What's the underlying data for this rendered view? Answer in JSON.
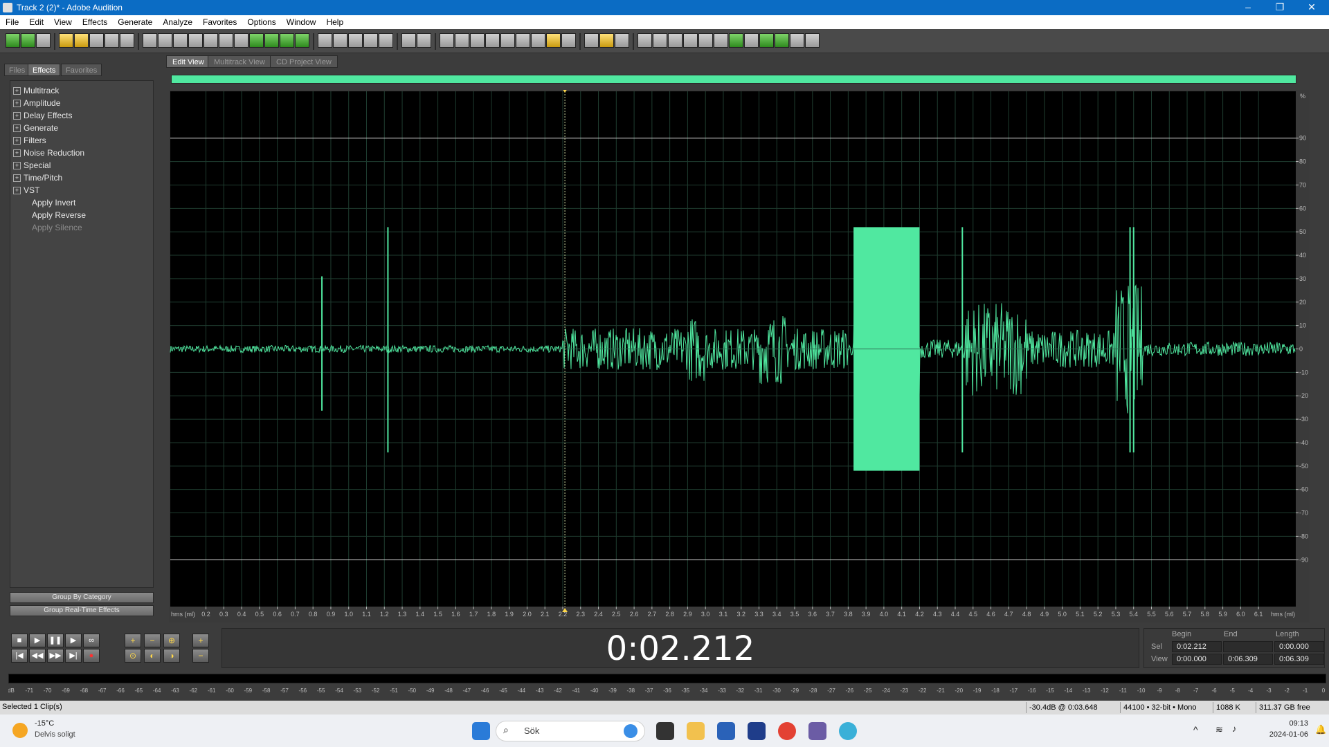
{
  "window": {
    "title": "Track 2 (2)* - Adobe Audition",
    "minimize": "–",
    "maximize": "❐",
    "close": "✕"
  },
  "menu": [
    "File",
    "Edit",
    "View",
    "Effects",
    "Generate",
    "Analyze",
    "Favorites",
    "Options",
    "Window",
    "Help"
  ],
  "panel": {
    "tabs": [
      "Files",
      "Effects",
      "Favorites"
    ],
    "active_tab": "Effects",
    "categories": [
      "Multitrack",
      "Amplitude",
      "Delay Effects",
      "Generate",
      "Filters",
      "Noise Reduction",
      "Special",
      "Time/Pitch",
      "VST"
    ],
    "actions": [
      "Apply Invert",
      "Apply Reverse",
      "Apply Silence"
    ],
    "group_by_category": "Group By Category",
    "group_realtime": "Group Real-Time Effects"
  },
  "views": {
    "tabs": [
      "Edit View",
      "Multitrack View",
      "CD Project View"
    ],
    "active": "Edit View"
  },
  "waveform": {
    "time_unit_left": "hms (ml)",
    "time_unit_right": "hms (ml)",
    "time_ticks": [
      "0.2",
      "0.3",
      "0.4",
      "0.5",
      "0.6",
      "0.7",
      "0.8",
      "0.9",
      "1.0",
      "1.1",
      "1.2",
      "1.3",
      "1.4",
      "1.5",
      "1.6",
      "1.7",
      "1.8",
      "1.9",
      "2.0",
      "2.1",
      "2.2",
      "2.3",
      "2.4",
      "2.5",
      "2.6",
      "2.7",
      "2.8",
      "2.9",
      "3.0",
      "3.1",
      "3.2",
      "3.3",
      "3.4",
      "3.5",
      "3.6",
      "3.7",
      "3.8",
      "3.9",
      "4.0",
      "4.1",
      "4.2",
      "4.3",
      "4.4",
      "4.5",
      "4.6",
      "4.7",
      "4.8",
      "4.9",
      "5.0",
      "5.1",
      "5.2",
      "5.3",
      "5.4",
      "5.5",
      "5.6",
      "5.7",
      "5.8",
      "5.9",
      "6.0",
      "6.1"
    ],
    "amplitude_unit": "%",
    "amplitude_ticks": [
      "90",
      "80",
      "70",
      "60",
      "50",
      "40",
      "30",
      "20",
      "10",
      "0",
      "-10",
      "-20",
      "-30",
      "-40",
      "-50",
      "-60",
      "-70",
      "-80",
      "-90"
    ],
    "cursor_time": 2.212,
    "color": "#50e8a0",
    "background": "#000000"
  },
  "transport": {
    "buttons": [
      "stop-icon",
      "play-icon",
      "pause-icon",
      "play-to-end-icon",
      "loop-icon"
    ],
    "buttons2": [
      "go-to-start-icon",
      "rewind-icon",
      "fast-forward-icon",
      "go-to-end-icon",
      "record-icon"
    ],
    "time_display": "0:02.212"
  },
  "selection": {
    "headers": [
      "Begin",
      "End",
      "Length"
    ],
    "sel_label": "Sel",
    "view_label": "View",
    "sel": [
      "0:02.212",
      "",
      "0:00.000"
    ],
    "view": [
      "0:00.000",
      "0:06.309",
      "0:06.309"
    ]
  },
  "meter_scale": [
    "dB",
    "-71",
    "-70",
    "-69",
    "-68",
    "-67",
    "-66",
    "-65",
    "-64",
    "-63",
    "-62",
    "-61",
    "-60",
    "-59",
    "-58",
    "-57",
    "-56",
    "-55",
    "-54",
    "-53",
    "-52",
    "-51",
    "-50",
    "-49",
    "-48",
    "-47",
    "-46",
    "-45",
    "-44",
    "-43",
    "-42",
    "-41",
    "-40",
    "-39",
    "-38",
    "-37",
    "-36",
    "-35",
    "-34",
    "-33",
    "-32",
    "-31",
    "-30",
    "-29",
    "-28",
    "-27",
    "-26",
    "-25",
    "-24",
    "-23",
    "-22",
    "-21",
    "-20",
    "-19",
    "-18",
    "-17",
    "-16",
    "-15",
    "-14",
    "-13",
    "-12",
    "-11",
    "-10",
    "-9",
    "-8",
    "-7",
    "-6",
    "-5",
    "-4",
    "-3",
    "-2",
    "-1",
    "0"
  ],
  "status": {
    "left": "Selected 1 Clip(s)",
    "level": "-30.4dB @",
    "level_time": "0:03.648",
    "format": "44100 • 32-bit • Mono",
    "size": "1088 K",
    "free": "311.37 GB free"
  },
  "taskbar": {
    "temp": "-15°C",
    "weather": "Delvis soligt",
    "search": "Sök",
    "time": "09:13",
    "date": "2024-01-06"
  }
}
